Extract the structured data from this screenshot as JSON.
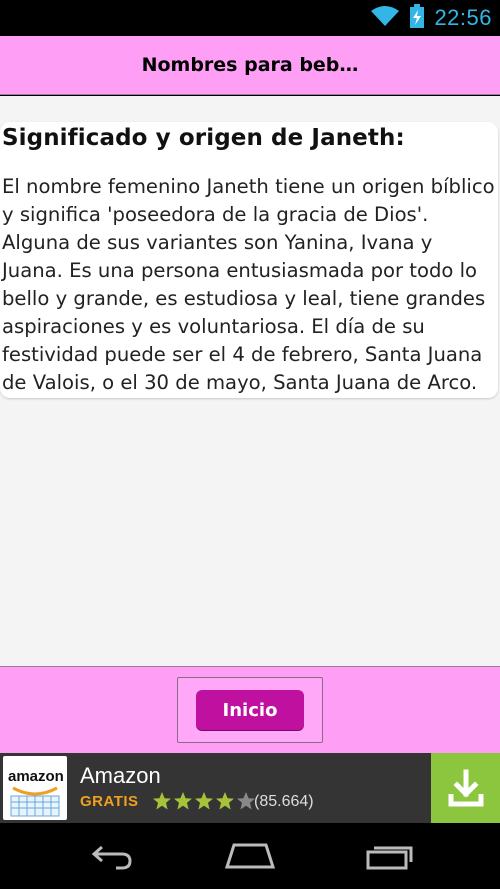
{
  "status_bar": {
    "time": "22:56",
    "icons": [
      "wifi-icon",
      "battery-charging-icon"
    ]
  },
  "header": {
    "title": "Nombres para beb…"
  },
  "card": {
    "title": "Significado y origen de Janeth:",
    "body": "El nombre femenino Janeth tiene un origen bíblico y significa 'poseedora de la gracia de Dios'. Alguna de sus variantes son Yanina, Ivana y Juana. Es una persona entusiasmada por todo lo bello y grande, es estudiosa y leal, tiene grandes aspiraciones y es voluntariosa. El día de su festividad puede ser el 4 de febrero, Santa Juana de Valois, o el 30 de mayo, Santa Juana de Arco."
  },
  "bottom": {
    "inicio_label": "Inicio"
  },
  "ad": {
    "logo_text": "amazon",
    "title": "Amazon",
    "price": "GRATIS",
    "rating": 4,
    "max_rating": 5,
    "reviews": "(85.664)",
    "icon": "download-icon"
  },
  "nav": {
    "icons": [
      "back-icon",
      "home-icon",
      "recent-apps-icon"
    ]
  },
  "colors": {
    "header_bg": "#ff9ef5",
    "button_bg": "#c0109f",
    "status_time": "#33b5e5",
    "ad_price": "#f0a020",
    "ad_download_bg": "#8cc63e"
  }
}
